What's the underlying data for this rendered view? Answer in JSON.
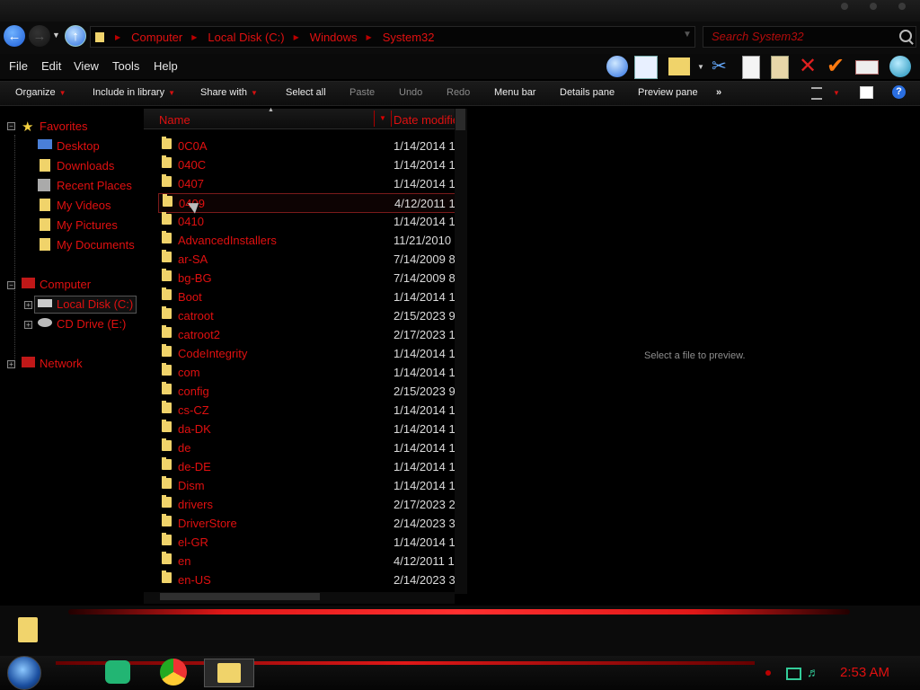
{
  "address": {
    "crumbs": [
      "Computer",
      "Local Disk (C:)",
      "Windows",
      "System32"
    ]
  },
  "search": {
    "placeholder": "Search System32"
  },
  "menu": [
    "File",
    "Edit",
    "View",
    "Tools",
    "Help"
  ],
  "commands": {
    "organize": "Organize",
    "include": "Include in library",
    "share": "Share with",
    "select_all": "Select all",
    "paste": "Paste",
    "undo": "Undo",
    "redo": "Redo",
    "menu_bar": "Menu bar",
    "details_pane": "Details pane",
    "preview_pane": "Preview pane",
    "more": "»"
  },
  "nav": {
    "favorites": "Favorites",
    "favorites_items": [
      "Desktop",
      "Downloads",
      "Recent Places",
      "My Videos",
      "My Pictures",
      "My Documents"
    ],
    "computer": "Computer",
    "computer_items": [
      "Local Disk (C:)",
      "CD Drive (E:)"
    ],
    "network": "Network"
  },
  "columns": {
    "name": "Name",
    "date": "Date modified"
  },
  "files": [
    {
      "name": "0C0A",
      "date": "1/14/2014 1"
    },
    {
      "name": "040C",
      "date": "1/14/2014 1"
    },
    {
      "name": "0407",
      "date": "1/14/2014 1"
    },
    {
      "name": "0409",
      "date": "4/12/2011 1"
    },
    {
      "name": "0410",
      "date": "1/14/2014 1"
    },
    {
      "name": "AdvancedInstallers",
      "date": "11/21/2010"
    },
    {
      "name": "ar-SA",
      "date": "7/14/2009 8"
    },
    {
      "name": "bg-BG",
      "date": "7/14/2009 8"
    },
    {
      "name": "Boot",
      "date": "1/14/2014 1"
    },
    {
      "name": "catroot",
      "date": "2/15/2023 9"
    },
    {
      "name": "catroot2",
      "date": "2/17/2023 1"
    },
    {
      "name": "CodeIntegrity",
      "date": "1/14/2014 1"
    },
    {
      "name": "com",
      "date": "1/14/2014 1"
    },
    {
      "name": "config",
      "date": "2/15/2023 9"
    },
    {
      "name": "cs-CZ",
      "date": "1/14/2014 1"
    },
    {
      "name": "da-DK",
      "date": "1/14/2014 1"
    },
    {
      "name": "de",
      "date": "1/14/2014 1"
    },
    {
      "name": "de-DE",
      "date": "1/14/2014 1"
    },
    {
      "name": "Dism",
      "date": "1/14/2014 1"
    },
    {
      "name": "drivers",
      "date": "2/17/2023 2"
    },
    {
      "name": "DriverStore",
      "date": "2/14/2023 3"
    },
    {
      "name": "el-GR",
      "date": "1/14/2014 1"
    },
    {
      "name": "en",
      "date": "4/12/2011 1"
    },
    {
      "name": "en-US",
      "date": "2/14/2023 3"
    }
  ],
  "selected_index": 3,
  "preview": {
    "text": "Select a file to preview."
  },
  "clock": "2:53 AM",
  "colors": {
    "accent": "#e01010",
    "folder": "#f0d36a",
    "background": "#000000"
  },
  "icons": {
    "back": "back-arrow-icon",
    "forward": "forward-arrow-icon",
    "up": "up-folder-icon",
    "search": "search-icon",
    "folder": "folder-icon"
  }
}
